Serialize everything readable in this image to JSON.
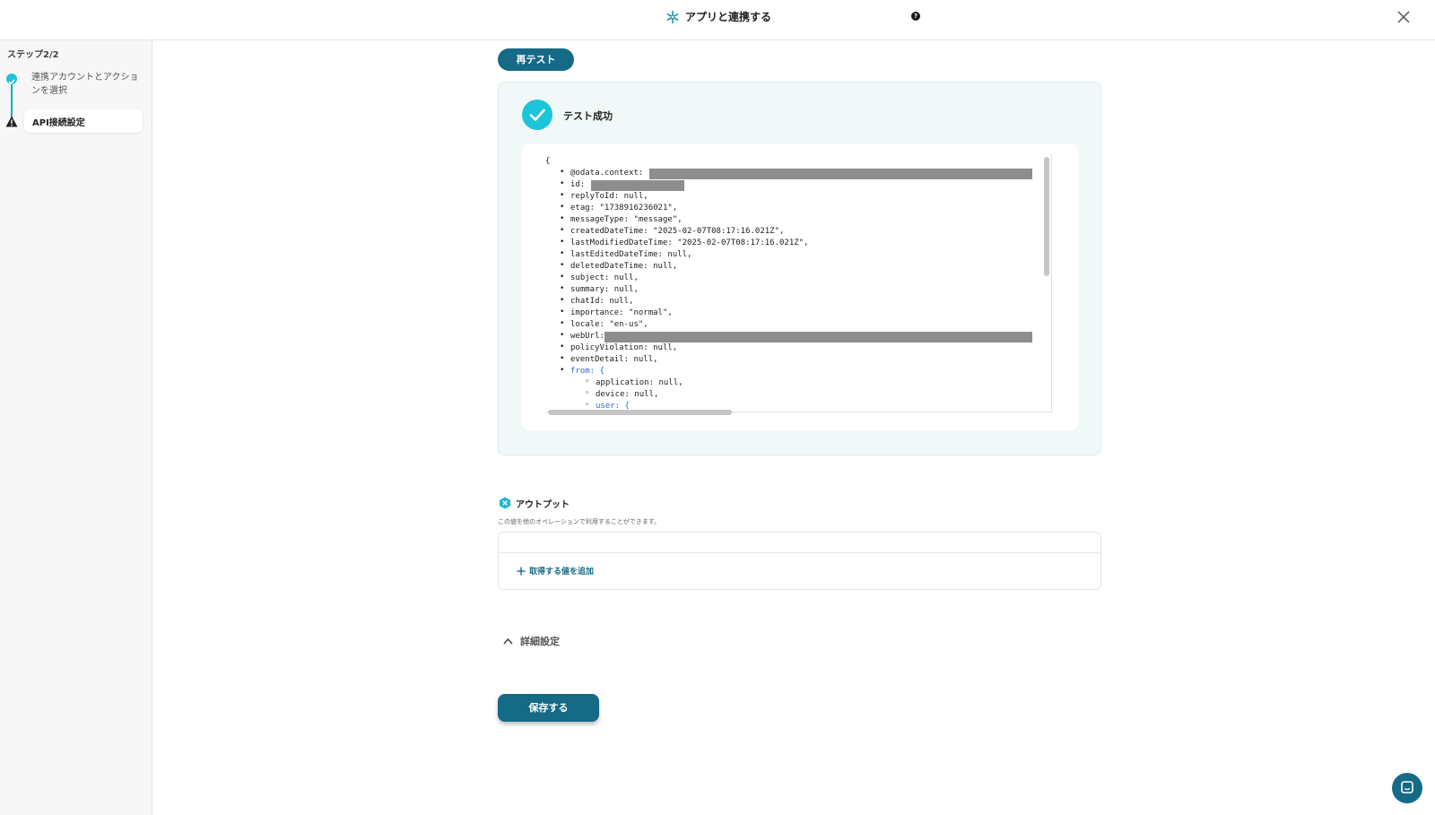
{
  "header": {
    "title": "アプリと連携する",
    "help_glyph": "?",
    "icons": {
      "logo": "yoom-asterisk-icon",
      "close": "close-icon"
    }
  },
  "sidebar": {
    "step_label": "ステップ2/2",
    "steps": [
      {
        "label": "連携アカウントとアクションを選択",
        "status": "done"
      },
      {
        "label": "API接続設定",
        "status": "warning",
        "active": true
      }
    ]
  },
  "main": {
    "retest_label": "再テスト",
    "success_label": "テスト成功",
    "json_lines": [
      "{",
      "@odata.context: \"",
      "id: \"",
      "replyToId: null,",
      "etag: \"1738916236021\",",
      "messageType: \"message\",",
      "createdDateTime: \"2025-02-07T08:17:16.021Z\",",
      "lastModifiedDateTime: \"2025-02-07T08:17:16.021Z\",",
      "lastEditedDateTime: null,",
      "deletedDateTime: null,",
      "subject: null,",
      "summary: null,",
      "chatId: null,",
      "importance: \"normal\",",
      "locale: \"en-us\",",
      "webUrl: ",
      "policyViolation: null,",
      "eventDetail: null,",
      "from: {",
      "application: null,",
      "device: null,",
      "user: {"
    ],
    "output": {
      "title": "アウトプット",
      "description": "この値を他のオペレーションで利用することができます。",
      "add_value_label": "取得する値を追加"
    },
    "details_label": "詳細設定",
    "save_label": "保存する"
  },
  "colors": {
    "primary": "#156a85",
    "accent": "#1ec4d9",
    "panel_bg": "#f1f8f8"
  }
}
